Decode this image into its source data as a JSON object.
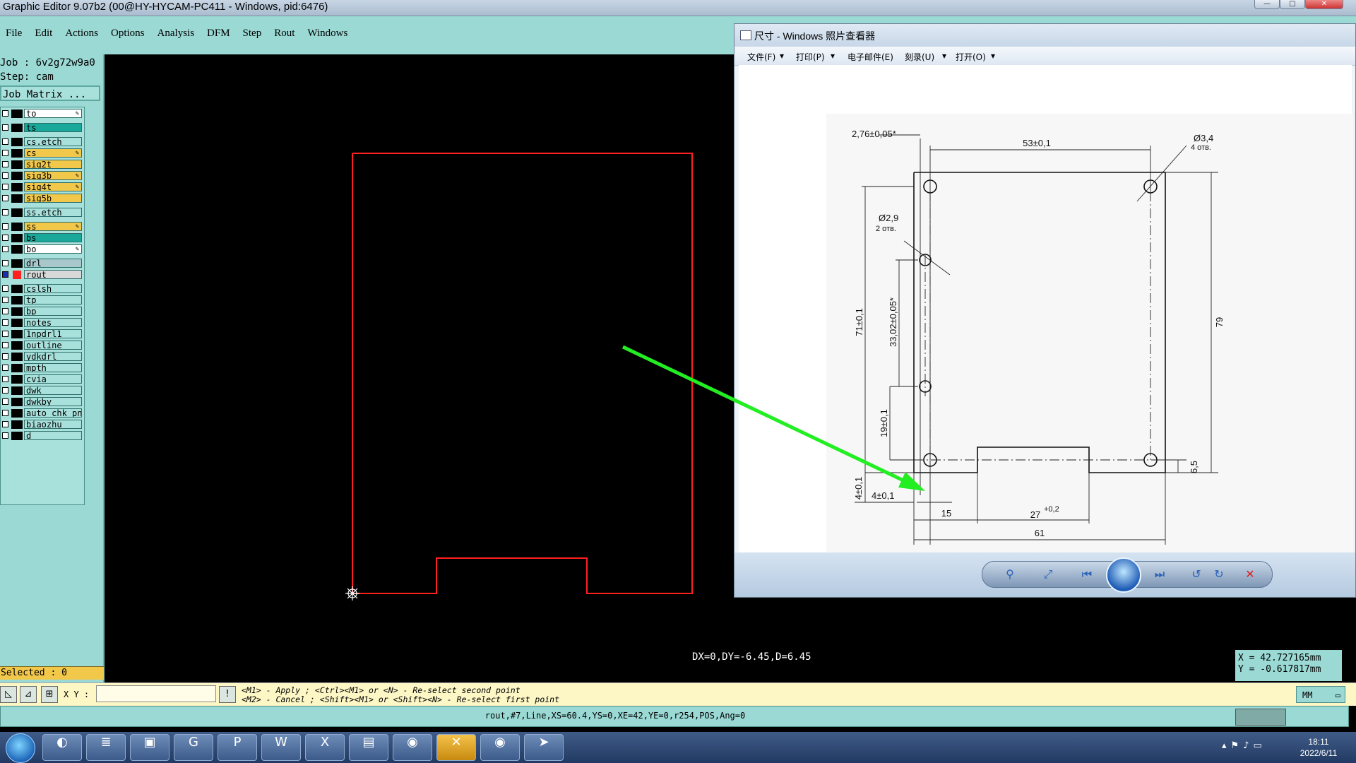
{
  "window": {
    "title": "Graphic Editor 9.07b2 (00@HY-HYCAM-PC411 - Windows, pid:6476)",
    "min": "—",
    "max": "□",
    "close": "✕"
  },
  "menu": {
    "items": [
      "File",
      "Edit",
      "Actions",
      "Options",
      "Analysis",
      "DFM",
      "Step",
      "Rout",
      "Windows"
    ]
  },
  "job": {
    "job_line": "Job : 6v2g72w9a0",
    "step_line": "Step: cam",
    "matrix_button": "Job Matrix ..."
  },
  "layers": [
    {
      "name": "to",
      "color": "#ffffff",
      "editable": true
    },
    {
      "name": "ts",
      "color": "#1aa89a",
      "editable": false
    },
    {
      "name": "cs.etch",
      "color": "#a8e0db",
      "editable": false
    },
    {
      "name": "cs",
      "color": "#f2c84b",
      "editable": true
    },
    {
      "name": "sig2t",
      "color": "#f2c84b",
      "editable": false
    },
    {
      "name": "sig3b",
      "color": "#f2c84b",
      "editable": true
    },
    {
      "name": "sig4t",
      "color": "#f2c84b",
      "editable": true
    },
    {
      "name": "sig5b",
      "color": "#f2c84b",
      "editable": false
    },
    {
      "name": "ss.etch",
      "color": "#a8e0db",
      "editable": false
    },
    {
      "name": "ss",
      "color": "#f2c84b",
      "editable": true
    },
    {
      "name": "bs",
      "color": "#1aa89a",
      "editable": false
    },
    {
      "name": "bo",
      "color": "#ffffff",
      "editable": true
    },
    {
      "name": "drl",
      "color": "#a8c8cc",
      "editable": false
    },
    {
      "name": "rout",
      "color": "#d8d8d8",
      "editable": false,
      "active": true
    },
    {
      "name": "cslsh",
      "color": "#a8e0db",
      "editable": false
    },
    {
      "name": "tp",
      "color": "#a8e0db",
      "editable": false
    },
    {
      "name": "bp",
      "color": "#a8e0db",
      "editable": false
    },
    {
      "name": "notes",
      "color": "#a8e0db",
      "editable": false
    },
    {
      "name": "1npdrl1",
      "color": "#a8e0db",
      "editable": false
    },
    {
      "name": "outline",
      "color": "#a8e0db",
      "editable": false
    },
    {
      "name": "ydkdrl",
      "color": "#a8e0db",
      "editable": false
    },
    {
      "name": "mpth",
      "color": "#a8e0db",
      "editable": false
    },
    {
      "name": "cvia",
      "color": "#a8e0db",
      "editable": false
    },
    {
      "name": "dwk",
      "color": "#a8e0db",
      "editable": false
    },
    {
      "name": "dwkby",
      "color": "#a8e0db",
      "editable": false
    },
    {
      "name": "auto_chk_pn",
      "color": "#a8e0db",
      "editable": false
    },
    {
      "name": "biaozhu",
      "color": "#a8e0db",
      "editable": false
    },
    {
      "name": "d",
      "color": "#a8e0db",
      "editable": false
    }
  ],
  "selected_label": "Selected : 0",
  "canvas": {
    "measure": "DX=0,DY=-6.45,D=6.45",
    "outline_color": "#ff2020",
    "arrow_color": "#22ee22"
  },
  "coords": {
    "x": "X = 42.727165mm",
    "y": "Y = -0.617817mm"
  },
  "command": {
    "xy_label": "X Y :",
    "xy_value": "",
    "hint1": "<M1> - Apply  ; <Ctrl><M1> or <N> - Re-select second point",
    "hint2": "<M2> - Cancel ; <Shift><M1> or <Shift><N> - Re-select first point",
    "units": "MM",
    "info_button": "!"
  },
  "status": "rout,#7,Line,XS=60.4,YS=0,XE=42,YE=0,r254,POS,Ang=0",
  "viewer": {
    "title": "尺寸 - Windows 照片查看器",
    "menu": [
      "文件(F)",
      "打印(P)",
      "电子邮件(E)",
      "刻录(U)",
      "打开(O)"
    ],
    "dims": {
      "d1": "2,76±0,05*",
      "d2": "53±0,1",
      "d3": "Ø3,4",
      "d3b": "4 отв.",
      "d4": "Ø2,9",
      "d4b": "2 отв.",
      "d5": "71±0,1",
      "d6": "33,02±0,05*",
      "d7": "19±0,1",
      "d8": "79",
      "d9": "6,5",
      "d10": "4±0,1",
      "d11": "4±0,1",
      "d12": "15",
      "d13": "27",
      "d13b": "+0,2",
      "d14": "61"
    }
  },
  "taskbar": {
    "time": "18:11",
    "date": "2022/6/11"
  }
}
